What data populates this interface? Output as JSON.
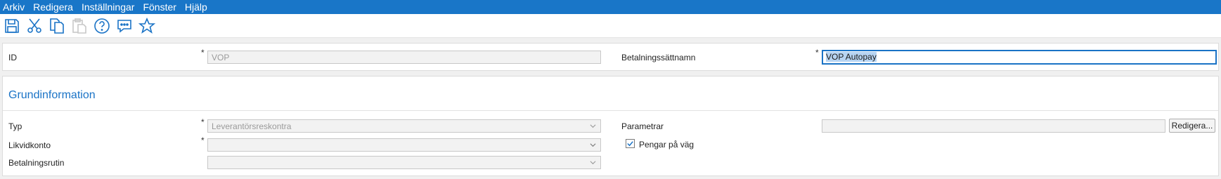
{
  "menu": [
    "Arkiv",
    "Redigera",
    "Inställningar",
    "Fönster",
    "Hjälp"
  ],
  "toolbar": {
    "icons": [
      "save-icon",
      "cut-icon",
      "copy-icon",
      "paste-icon",
      "help-icon",
      "chat-icon",
      "favorite-icon"
    ],
    "accent": "#1a73c6"
  },
  "header": {
    "id_label": "ID",
    "id_value": "VOP",
    "name_label": "Betalningssättnamn",
    "name_value": "VOP Autopay",
    "required_mark": "*"
  },
  "section": {
    "title": "Grundinformation",
    "typ_label": "Typ",
    "typ_value": "Leverantörsreskontra",
    "likvid_label": "Likvidkonto",
    "likvid_value": "",
    "rutin_label": "Betalningsrutin",
    "rutin_value": "",
    "param_label": "Parametrar",
    "param_value": "",
    "edit_button": "Redigera...",
    "pengar_label": "Pengar på väg",
    "pengar_checked": true
  },
  "colors": {
    "menubar": "#1976c8",
    "accent": "#1a73c6",
    "selection": "#b7d4f2"
  }
}
